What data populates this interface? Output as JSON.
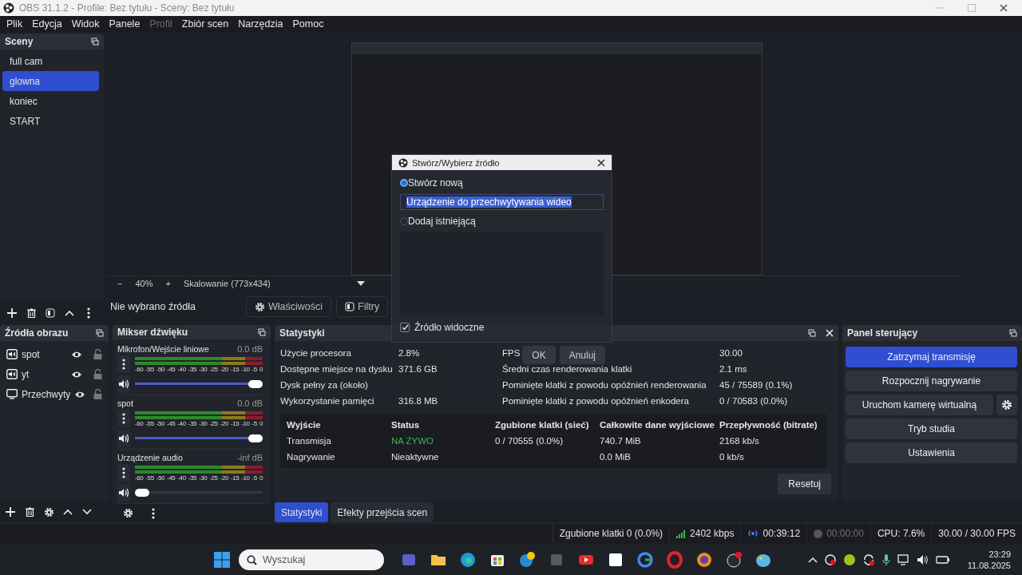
{
  "window": {
    "title": "OBS 31.1.2 - Profile: Bez tytułu - Sceny: Bez tytułu"
  },
  "menu": [
    {
      "label": "Plik",
      "disabled": false
    },
    {
      "label": "Edycja",
      "disabled": false
    },
    {
      "label": "Widok",
      "disabled": false
    },
    {
      "label": "Panele",
      "disabled": false
    },
    {
      "label": "Profil",
      "disabled": true
    },
    {
      "label": "Zbiór scen",
      "disabled": false
    },
    {
      "label": "Narzędzia",
      "disabled": false
    },
    {
      "label": "Pomoc",
      "disabled": false
    }
  ],
  "scenes": {
    "title": "Sceny",
    "items": [
      {
        "label": "full cam",
        "selected": false
      },
      {
        "label": "glowna",
        "selected": true
      },
      {
        "label": "koniec",
        "selected": false
      },
      {
        "label": "START",
        "selected": false
      }
    ]
  },
  "preview": {
    "minus": "−",
    "zoom": "40%",
    "plus": "+",
    "scaling": "Skalowanie (773x434)"
  },
  "source_bar": {
    "label": "Nie wybrano źródła",
    "properties": "Właściwości",
    "filters": "Filtry"
  },
  "sources": {
    "title": "Źródła obrazu",
    "items": [
      {
        "label": "spot",
        "kind": "media",
        "visible": true,
        "locked": false
      },
      {
        "label": "yt",
        "kind": "media",
        "visible": true,
        "locked": false
      },
      {
        "label": "Przechwyty",
        "kind": "display",
        "visible": true,
        "locked": false
      }
    ]
  },
  "mixer": {
    "title": "Mikser dźwięku",
    "channels": [
      {
        "name": "Mikrofon/Wejście liniowe",
        "reading": "0.0 dB",
        "level": 1,
        "scale": [
          "-60",
          "-55",
          "-50",
          "-45",
          "-40",
          "-35",
          "-30",
          "-25",
          "-20",
          "-15",
          "-10",
          "-5",
          "0"
        ]
      },
      {
        "name": "spot",
        "reading": "0.0 dB",
        "level": 1,
        "scale": [
          "-60",
          "-55",
          "-50",
          "-45",
          "-40",
          "-35",
          "-30",
          "-25",
          "-20",
          "-15",
          "-10",
          "-5",
          "0"
        ]
      },
      {
        "name": "Urządzenie audio",
        "reading": "-inf dB",
        "level": 0,
        "scale": [
          "-60",
          "-55",
          "-50",
          "-45",
          "-40",
          "-35",
          "-30",
          "-25",
          "-20",
          "-15",
          "-10",
          "-5",
          "0"
        ]
      }
    ]
  },
  "stats": {
    "title": "Statystyki",
    "left": [
      {
        "label": "Użycie procesora",
        "value": "2.8%"
      },
      {
        "label": "Dostępne miejsce na dysku",
        "value": "371.6 GB"
      },
      {
        "label": "Dysk pełny za (około)"
      },
      {
        "label": "Wykorzystanie pamięci",
        "value": "316.8 MB"
      }
    ],
    "right": [
      {
        "label": "FPS",
        "value": "30.00"
      },
      {
        "label": "Średni czas renderowania klatki",
        "value": "2.1 ms"
      },
      {
        "label": "Pominięte klatki z powodu opóźnień renderowania",
        "value": "45 / 75589 (0.1%)"
      },
      {
        "label": "Pominięte klatki z powodu opóźnień enkodera",
        "value": "0 / 70583 (0.0%)"
      }
    ],
    "table": {
      "columns": [
        "Wyjście",
        "Status",
        "Zgubione klatki (sieć)",
        "Całkowite dane wyjściowe",
        "Przepływność (bitrate)"
      ],
      "rows": [
        {
          "output": "Transmisja",
          "status": "NA ŻYWO",
          "live": true,
          "dropped": "0 / 70555 (0.0%)",
          "total": "740.7 MiB",
          "bitrate": "2168 kb/s"
        },
        {
          "output": "Nagrywanie",
          "status": "Nieaktywne",
          "live": false,
          "total": "0.0 MiB",
          "bitrate": "0 kb/s"
        }
      ]
    },
    "reset": "Resetuj"
  },
  "dock_tabs": [
    {
      "label": "Statystyki",
      "selected": true
    },
    {
      "label": "Efekty przejścia scen",
      "selected": false
    }
  ],
  "controls": {
    "title": "Panel sterujący",
    "buttons": [
      {
        "label": "Zatrzymaj transmisję",
        "active": true
      },
      {
        "label": "Rozpocznij nagrywanie",
        "active": false
      },
      {
        "label": "Uruchom kamerę wirtualną",
        "active": false
      },
      {
        "label": "Tryb studia",
        "active": false
      },
      {
        "label": "Ustawienia",
        "active": false
      }
    ]
  },
  "status_bar": {
    "dropped": "Zgubione klatki 0 (0.0%)",
    "bitrate": "2402 kbps",
    "stream_time": "00:39:12",
    "record_time": "00:00:00",
    "cpu": "CPU: 7.6%",
    "fps": "30.00 / 30.00 FPS"
  },
  "dialog": {
    "title": "Stwórz/Wybierz źródło",
    "options": [
      {
        "label": "Stwórz nową",
        "selected": true
      },
      {
        "label": "Dodaj istniejącą",
        "selected": false
      }
    ],
    "name_value": "Urządzenie do przechwytywania wideo",
    "visible_label": "Źródło widoczne",
    "visible_checked": true,
    "buttons": [
      "OK",
      "Anuluj"
    ]
  },
  "taskbar": {
    "search_placeholder": "Wyszukaj",
    "time": "23:29",
    "date": "11.08.2025"
  }
}
